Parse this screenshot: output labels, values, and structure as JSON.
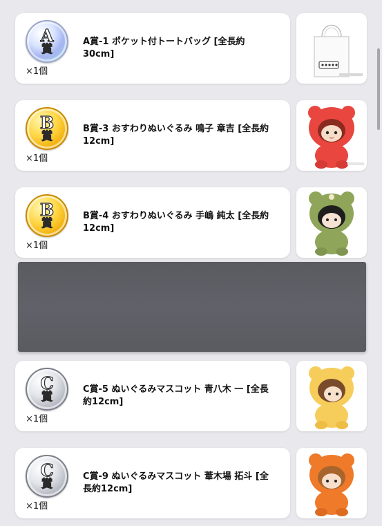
{
  "prizes": [
    {
      "name": "A賞-1 ポケット付トートバッグ [全長約30cm]",
      "qty": "×1個",
      "badge_letter": "A",
      "badge_kanji": "賞",
      "badge_style": "silver-blue",
      "image_icon": "tote-bag-icon"
    },
    {
      "name": "B賞-3 おすわりぬいぐるみ 鳴子 章吉 [全長約12cm]",
      "qty": "×1個",
      "badge_letter": "B",
      "badge_kanji": "賞",
      "badge_style": "gold",
      "image_icon": "red-bear-plush-icon",
      "image_color": "#e8463f"
    },
    {
      "name": "B賞-4 おすわりぬいぐるみ 手嶋 純太 [全長約12cm]",
      "qty": "×1個",
      "badge_letter": "B",
      "badge_kanji": "賞",
      "badge_style": "gold",
      "image_icon": "green-bear-plush-icon",
      "image_color": "#8fa65a"
    },
    {
      "name": "C賞-5 ぬいぐるみマスコット 青八木 一 [全長約12cm]",
      "qty": "×1個",
      "badge_letter": "C",
      "badge_kanji": "賞",
      "badge_style": "silver",
      "image_icon": "yellow-bear-plush-icon",
      "image_color": "#f6cd5a"
    },
    {
      "name": "C賞-9 ぬいぐるみマスコット 葦木場 拓斗 [全長約12cm]",
      "qty": "×1個",
      "badge_letter": "C",
      "badge_kanji": "賞",
      "badge_style": "silver",
      "image_icon": "orange-bear-plush-icon",
      "image_color": "#ee7a2a"
    }
  ]
}
